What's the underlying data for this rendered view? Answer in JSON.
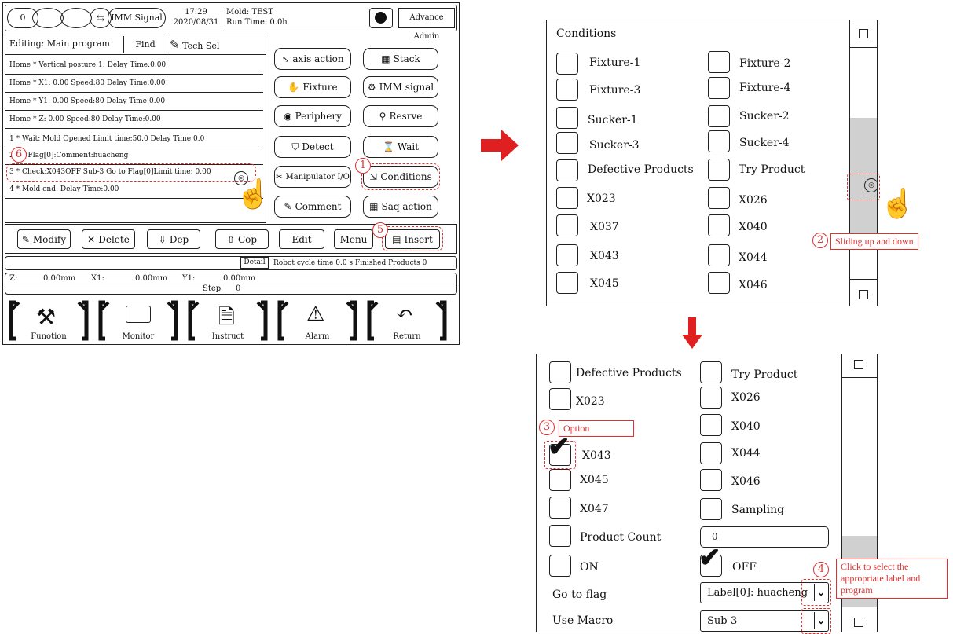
{
  "header": {
    "counter": "0",
    "imm_signal": "IMM Signal",
    "time": "17:29",
    "date": "2020/08/31",
    "mold_line": "Mold: TEST",
    "run_line": "Run Time: 0.0h",
    "user": "Advance Admin"
  },
  "editbar": {
    "editing": "Editing: Main program",
    "find": "Find",
    "tech_sel": "Tech Sel"
  },
  "program_rows": [
    "Home   *  Vertical posture 1: Delay Time:0.00",
    "Home   *  X1: 0.00 Speed:80  Delay Time:0.00",
    "Home   *  Y1: 0.00 Speed:80  Delay Time:0.00",
    "Home   *  Z: 0.00 Speed:80   Delay Time:0.00",
    "1    *  Wait: Mold Opened Limit time:50.0  Delay Time:0.0",
    "2    *   #Flag[0]:Comment:huacheng",
    "3    *   Check:X043OFF Sub-3 Go to Flag[0]Limit time: 0.00",
    "4    *   Mold end:  Delay Time:0.00"
  ],
  "commands": {
    "axis_action": "axis action",
    "stack": "Stack",
    "fixture": "Fixture",
    "imm_signal": "IMM signal",
    "periphery": "Periphery",
    "reserve": "Resrve",
    "detect": "Detect",
    "wait": "Wait",
    "manipulator_io": "Manipulator I/O",
    "conditions": "Conditions",
    "comment": "Comment",
    "saq_action": "Saq action"
  },
  "toolbar": {
    "modify": "Modify",
    "delete": "Delete",
    "dep": "Dep",
    "cop": "Cop",
    "edit": "Edit",
    "menu": "Menu",
    "insert": "Insert"
  },
  "status": {
    "detail": "Detail",
    "cycle": "Robot cycle time 0.0 s Finished Products  0",
    "z": "Z:",
    "z_val": "0.00mm",
    "x1": "X1:",
    "x1_val": "0.00mm",
    "y1": "Y1:",
    "y1_val": "0.00mm",
    "step": "Step",
    "step_val": "0"
  },
  "nav": {
    "function": "Funotion",
    "monitor": "Monitor",
    "instruct": "Instruct",
    "alarm": "Alarm",
    "return": "Return"
  },
  "conditions_panel": {
    "title": "Conditions",
    "left": [
      "Fixture-1",
      "Fixture-3",
      "Sucker-1",
      "Sucker-3",
      "Defective Products",
      "X023",
      "X037",
      "X043",
      "X045"
    ],
    "right": [
      "Fixture-2",
      "Fixture-4",
      "Sucker-2",
      "Sucker-4",
      "Try Product",
      "X026",
      "X040",
      "X044",
      "X046"
    ]
  },
  "option_panel": {
    "left": [
      "Defective Products",
      "X023",
      "X043",
      "X045",
      "X047",
      "Product Count",
      "ON"
    ],
    "right": [
      "Try Product",
      "X026",
      "X040",
      "X044",
      "X046",
      "Sampling"
    ],
    "product_count_value": "0",
    "off_label": "OFF",
    "go_to_flag_label": "Go to flag",
    "go_to_flag_value": "Label[0]: huacheng",
    "use_macro_label": "Use Macro",
    "use_macro_value": "Sub-3",
    "x043_checked": true,
    "off_checked": true
  },
  "annotations": {
    "n1": "1",
    "n2": "2",
    "n3": "3",
    "n4": "4",
    "n5": "5",
    "n6": "6",
    "sliding": "Sliding up and down",
    "option": "Option",
    "click_select": "Click to select the appropriate label and program"
  },
  "colors": {
    "accent_red": "#e03030",
    "scroll_thumb": "#d0d0d0"
  }
}
